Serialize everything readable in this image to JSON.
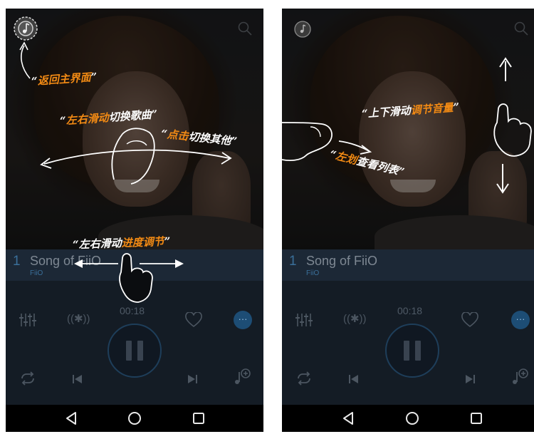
{
  "screens": [
    {
      "id": "left",
      "annotations": {
        "back": [
          "“",
          "返回主界面",
          "”"
        ],
        "swipe_song": [
          "“",
          "左右滑动",
          "切换歌曲",
          "”"
        ],
        "tap_other": [
          "“",
          "点击",
          "切换其他",
          "”"
        ],
        "progress": [
          "“",
          "左右滑动",
          "进度调节",
          "”"
        ]
      }
    },
    {
      "id": "right",
      "annotations": {
        "volume": [
          "“",
          "上下滑动",
          "调节音量",
          "”"
        ],
        "playlist": [
          "“",
          "左划",
          "查看列表",
          "”"
        ]
      }
    }
  ],
  "player": {
    "track_number": "1",
    "track_title": "Song of FiiO",
    "track_artist": "FiiO",
    "time": "00:18",
    "more_label": "···",
    "bluetooth_label": "((✱))"
  },
  "icons": {
    "home": "music-note-icon",
    "search": "search-icon",
    "equalizer": "equalizer-icon",
    "bluetooth": "bluetooth-icon",
    "favorite": "heart-icon",
    "more": "more-icon",
    "pause": "pause-icon",
    "repeat": "repeat-icon",
    "previous": "previous-icon",
    "next": "next-icon",
    "add_to_playlist": "add-music-icon",
    "nav_back": "back-triangle-icon",
    "nav_home": "home-circle-icon",
    "nav_recents": "recents-square-icon"
  },
  "colors": {
    "annotation_highlight": "#f28a14",
    "annotation_text": "#ffffff",
    "accent": "#1d4d75",
    "panel_bg": "#141c25"
  }
}
